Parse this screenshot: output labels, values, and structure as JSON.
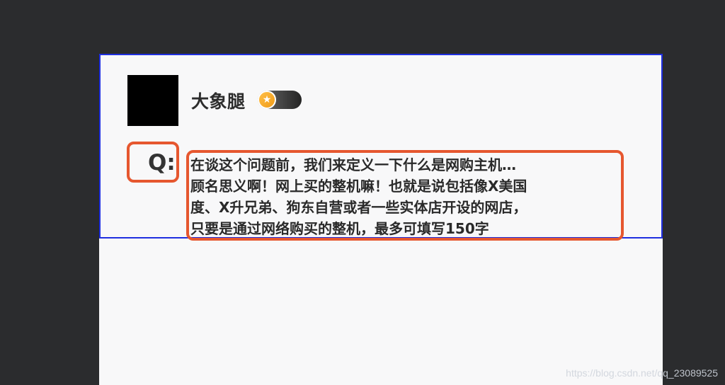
{
  "user": {
    "name": "大象腿",
    "badge_icon": "star-medal-icon"
  },
  "qa": {
    "question_label": "Q:",
    "answer_text": "在谈这个问题前，我们来定义一下什么是网购主机…\n顾名思义啊！网上买的整机嘛！也就是说包括像X美国\n度、X升兄弟、狗东自营或者一些实体店开设的网店，\n只要是通过网络购买的整机，最多可填写150字"
  },
  "watermark": {
    "text": "https://blog.csdn.net/qq_23089525"
  },
  "colors": {
    "background": "#2b2c2e",
    "card": "#f8f8f9",
    "border_blue": "#1f2fe0",
    "highlight_orange": "#e6572f"
  }
}
